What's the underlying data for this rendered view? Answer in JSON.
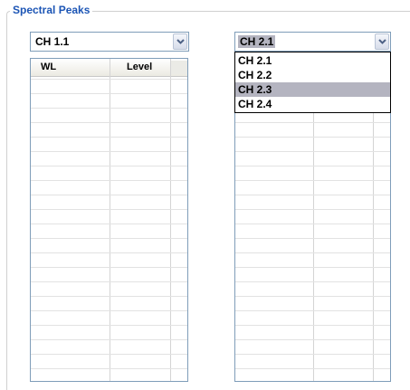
{
  "group": {
    "title": "Spectral Peaks"
  },
  "left": {
    "combo_value": "CH 1.1",
    "columns": [
      "WL",
      "Level"
    ]
  },
  "right": {
    "combo_value": "CH 2.1",
    "options": [
      "CH 2.1",
      "CH 2.2",
      "CH 2.3",
      "CH 2.4"
    ],
    "highlighted_option": "CH 2.3"
  },
  "icons": {
    "combo_arrow": "chevron-down-icon"
  }
}
